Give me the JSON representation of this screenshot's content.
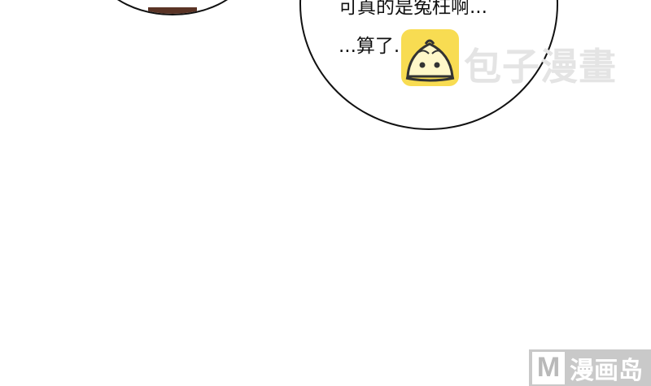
{
  "speech": {
    "line1": "可真的是冤枉啊...",
    "line2": "...算了..."
  },
  "watermark": {
    "text": "包子漫畫",
    "icon": "steamed-bun-icon",
    "icon_color": "#f8dc52"
  },
  "corner_logo": {
    "badge": "M",
    "text": "漫画岛"
  }
}
